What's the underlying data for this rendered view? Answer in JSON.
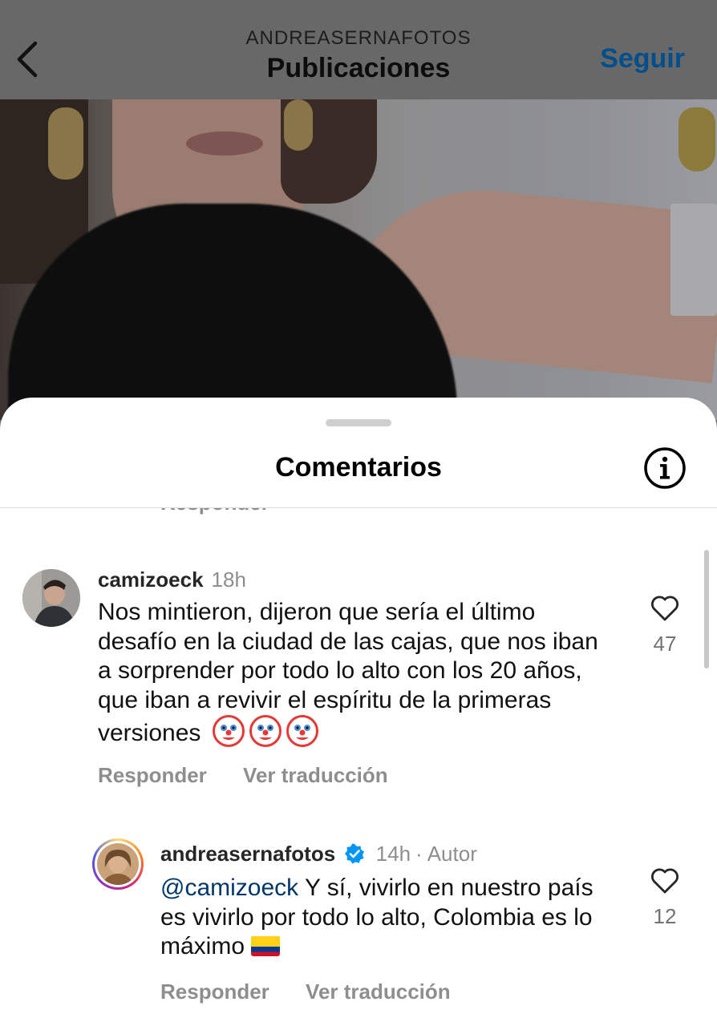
{
  "header": {
    "account_name": "ANDREASERNAFOTOS",
    "title": "Publicaciones",
    "follow_label": "Seguir"
  },
  "sheet": {
    "title": "Comentarios",
    "cut_off_reply_label": "Responder"
  },
  "comments": [
    {
      "username": "camizoeck",
      "time": "18h",
      "text": "Nos mintieron, dijeron que sería el último desafío en la ciudad de las cajas, que nos iban a sorprender por todo lo alto con los 20 años, que iban a revivir el espíritu de la primeras versiones",
      "emoji": [
        "clown-face",
        "clown-face",
        "clown-face"
      ],
      "likes": "47",
      "reply_label": "Responder",
      "translate_label": "Ver traducción"
    },
    {
      "username": "andreasernafotos",
      "verified": true,
      "time": "14h",
      "separator": "·",
      "author_badge": "Autor",
      "mention": "@camizoeck",
      "text": "Y sí, vivirlo en nuestro país es vivirlo por todo lo alto, Colombia es lo máximo",
      "emoji": [
        "colombia-flag"
      ],
      "likes": "12",
      "reply_label": "Responder",
      "translate_label": "Ver traducción"
    }
  ],
  "colors": {
    "follow": "#004f8c",
    "mention": "#00376b",
    "verified": "#0095f6",
    "secondary_text": "#8e8e8e"
  }
}
